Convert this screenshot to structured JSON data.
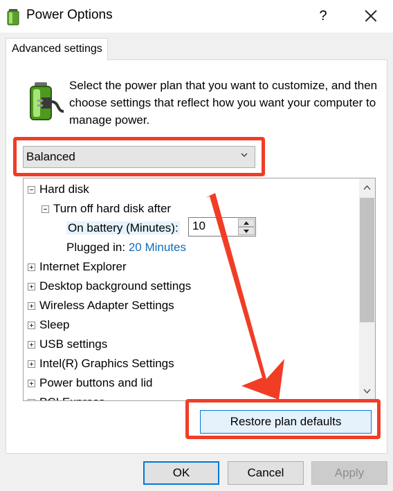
{
  "window": {
    "title": "Power Options",
    "help_glyph": "?",
    "close_glyph": "✕"
  },
  "tab": {
    "label": "Advanced settings"
  },
  "intro_text": "Select the power plan that you want to customize, and then choose settings that reflect how you want your computer to manage power.",
  "plan_select": {
    "value": "Balanced"
  },
  "tree": {
    "items": [
      {
        "label": "Hard disk",
        "state": "expanded"
      },
      {
        "label": "Turn off hard disk after",
        "state": "expanded"
      },
      {
        "label": "On battery (Minutes):",
        "value": "10"
      },
      {
        "label": "Plugged in:",
        "value": "20 Minutes"
      },
      {
        "label": "Internet Explorer",
        "state": "collapsed"
      },
      {
        "label": "Desktop background settings",
        "state": "collapsed"
      },
      {
        "label": "Wireless Adapter Settings",
        "state": "collapsed"
      },
      {
        "label": "Sleep",
        "state": "collapsed"
      },
      {
        "label": "USB settings",
        "state": "collapsed"
      },
      {
        "label": "Intel(R) Graphics Settings",
        "state": "collapsed"
      },
      {
        "label": "Power buttons and lid",
        "state": "collapsed"
      },
      {
        "label": "PCI Express",
        "state": "collapsed"
      }
    ]
  },
  "restore_button": {
    "label": "Restore plan defaults"
  },
  "footer": {
    "ok_label": "OK",
    "cancel_label": "Cancel",
    "apply_label": "Apply"
  },
  "colors": {
    "annotation_red": "#f13d26",
    "accent_blue": "#0078d7",
    "link_blue": "#0f6cbd"
  }
}
